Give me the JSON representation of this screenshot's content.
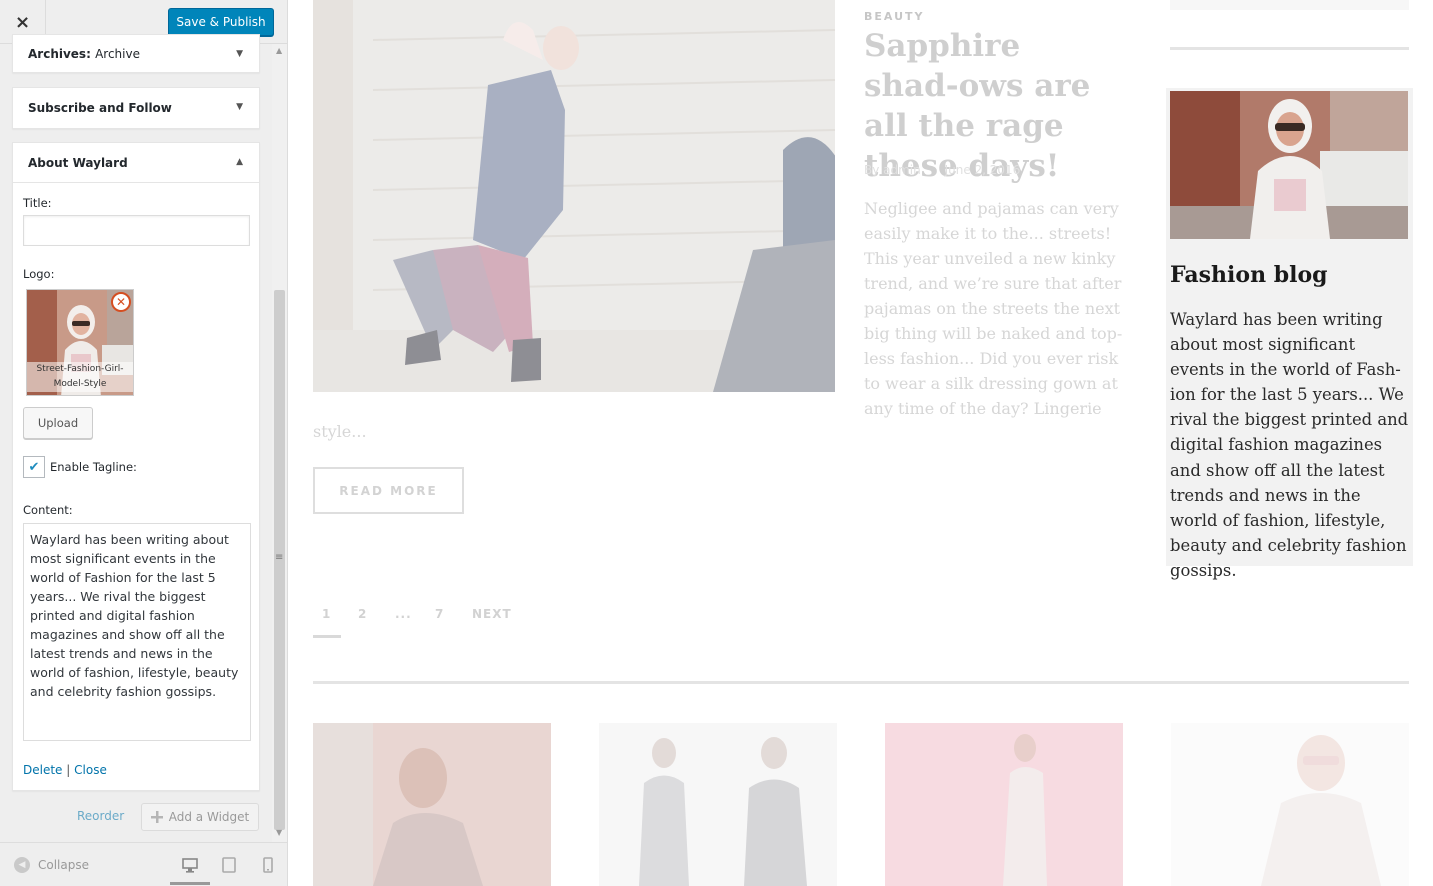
{
  "customizer": {
    "close_label": "×",
    "publish_label": "Save & Publish",
    "widgets": [
      {
        "title": "Archives:",
        "subtitle": "Archive",
        "arrow": "▼"
      },
      {
        "title": "Subscribe and Follow",
        "arrow": "▼"
      },
      {
        "title": "About Waylard",
        "arrow": "▲"
      }
    ],
    "about": {
      "title_label": "Title:",
      "title_value": "",
      "logo_label": "Logo:",
      "logo_caption": "Street-Fashion-Girl-Model-Style",
      "logo_remove_glyph": "✕",
      "upload_label": "Upload",
      "tagline_checked_glyph": "✔",
      "tagline_label": "Enable Tagline:",
      "content_label": "Content:",
      "content_value": "Waylard has been writing about most significant events in the world of Fashion for the last 5 years... We rival the biggest printed and digital fashion magazines and show off all the latest trends and news in the world of fashion, lifestyle, beauty and celebrity fashion gossips.",
      "delete_label": "Delete",
      "link_separator": "|",
      "close_label": "Close"
    },
    "reorder_label": "Reorder",
    "add_widget_icon": "plus-icon",
    "add_widget_label": "Add a Widget",
    "collapse_label": "Collapse",
    "devices": [
      "desktop-icon",
      "tablet-icon",
      "mobile-icon"
    ]
  },
  "preview": {
    "post": {
      "category": "BEAUTY",
      "title": "Sapphire shad-ows are all the rage these days!",
      "author": "By admin",
      "date": "June 2, 2016",
      "excerpt": "Negligee and pajamas can very easily make it to the... streets! This year unveiled a new kinky trend, and we’re sure that after pajamas on the streets the next big thing will be naked and top-less fashion... Did you ever risk to wear a silk dressing gown at any time of the day? Lingerie",
      "excerpt_tail": "style...",
      "read_more": "READ MORE"
    },
    "pagination": [
      "1",
      "2",
      "...",
      "7",
      "NEXT"
    ],
    "sidebar_widget": {
      "title": "Fashion blog",
      "text": "Waylard has been writing about most significant events in the world of Fash-ion for the last 5 years... We rival the biggest printed and digital fashion magazines and show off all the latest trends and news in the world of fashion, lifestyle, beauty and celebrity fashion gossips."
    }
  },
  "colors": {
    "publish_button": "#0085ba",
    "link": "#0073aa",
    "remove_badge": "#d54e21",
    "widget_highlight": "#f2f2f2"
  }
}
